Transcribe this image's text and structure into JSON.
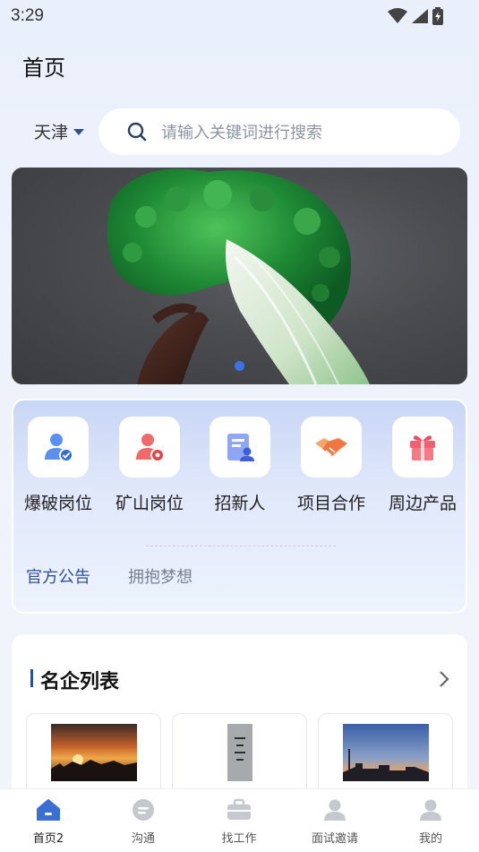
{
  "status_bar": {
    "time": "3:29"
  },
  "header": {
    "title": "首页"
  },
  "search": {
    "city": "天津",
    "placeholder": "请输入关键词进行搜索"
  },
  "categories": [
    {
      "label": "爆破岗位",
      "icon": "user-check-icon"
    },
    {
      "label": "矿山岗位",
      "icon": "user-badge-icon"
    },
    {
      "label": "招新人",
      "icon": "document-user-icon"
    },
    {
      "label": "项目合作",
      "icon": "handshake-icon"
    },
    {
      "label": "周边产品",
      "icon": "gift-icon"
    }
  ],
  "notice_tabs": [
    {
      "label": "官方公告",
      "active": true
    },
    {
      "label": "拥抱梦想",
      "active": false
    }
  ],
  "company_list": {
    "title": "名企列表"
  },
  "tabs": [
    {
      "label": "首页2",
      "icon": "home-icon",
      "active": true
    },
    {
      "label": "沟通",
      "icon": "chat-icon",
      "active": false
    },
    {
      "label": "找工作",
      "icon": "briefcase-icon",
      "active": false
    },
    {
      "label": "面试邀请",
      "icon": "interview-icon",
      "active": false
    },
    {
      "label": "我的",
      "icon": "profile-icon",
      "active": false
    }
  ],
  "colors": {
    "accent": "#2d4f93",
    "active_tab": "#3b6fd6",
    "notice_active": "#2d4f93",
    "notice_inactive": "#7a8090"
  }
}
